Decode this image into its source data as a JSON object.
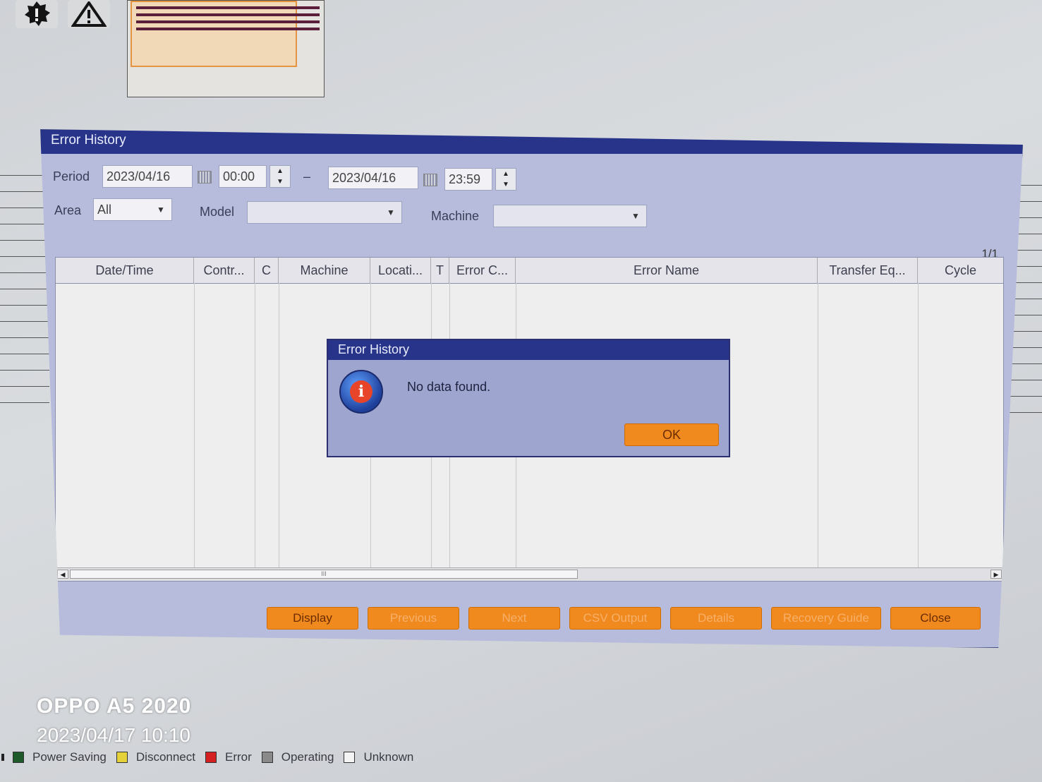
{
  "top_icons": [
    {
      "name": "gear-icon"
    },
    {
      "name": "warning-icon"
    }
  ],
  "window": {
    "title": "Error History",
    "period_label": "Period",
    "start_date": "2023/04/16",
    "start_time": "00:00",
    "range_separator": "–",
    "end_date": "2023/04/16",
    "end_time": "23:59",
    "area_label": "Area",
    "area_value": "All",
    "model_label": "Model",
    "model_value": "",
    "machine_label": "Machine",
    "machine_value": "",
    "page_indicator": "1/1"
  },
  "table": {
    "columns": [
      "Date/Time",
      "Contr...",
      "C",
      "Machine",
      "Locati...",
      "T",
      "Error C...",
      "Error Name",
      "Transfer Eq...",
      "Cycle"
    ],
    "rows": [],
    "scroll_thumb_glyph": "III"
  },
  "buttons": {
    "display": "Display",
    "previous": "Previous",
    "next": "Next",
    "csv_output": "CSV Output",
    "details": "Details",
    "recovery_guide": "Recovery Guide",
    "close": "Close"
  },
  "dialog": {
    "title": "Error History",
    "message": "No data found.",
    "ok": "OK"
  },
  "photo_watermark": {
    "device": "OPPO A5 2020",
    "timestamp": "2023/04/17 10:10"
  },
  "legend": [
    {
      "label": "Power Saving",
      "color": "#1f5a2a"
    },
    {
      "label": "Disconnect",
      "color": "#e5d23a"
    },
    {
      "label": "Error",
      "color": "#d42020"
    },
    {
      "label": "Operating",
      "color": "#8a8a8a"
    },
    {
      "label": "Unknown",
      "color": "#f4f4f4"
    }
  ],
  "colors": {
    "title_bar": "#28348a",
    "window_bg": "#b7bcdc",
    "accent_button": "#f08a1f"
  }
}
